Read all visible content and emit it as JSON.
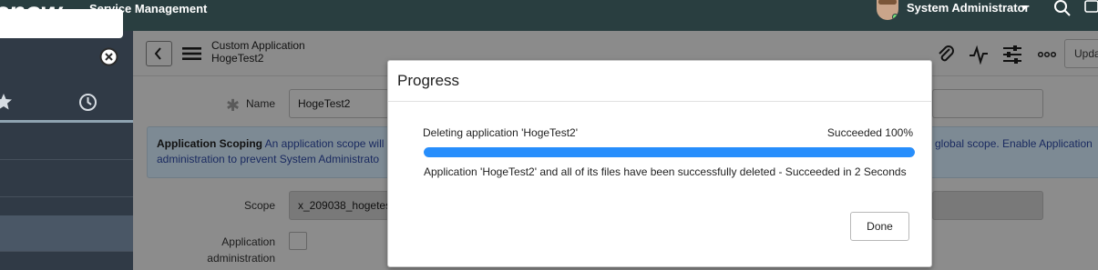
{
  "banner": {
    "logo_text": "enow",
    "app_name": "Service Management",
    "user_name": "System Administrator"
  },
  "icons": {
    "search": "search-icon",
    "chat": "chat-icon",
    "clear": "clear-filter-icon",
    "favorites": "star-icon",
    "history": "clock-icon",
    "attachment": "paperclip-icon",
    "activity": "activity-icon",
    "settings": "sliders-icon",
    "more": "more-options-icon"
  },
  "form": {
    "title_line1": "Custom Application",
    "title_line2": "HogeTest2",
    "update_label": "Upda",
    "name_label": "Name",
    "name_value": "HogeTest2",
    "scope_notice_heading": "Application Scoping",
    "scope_notice_line1_start": "An application scope will p",
    "scope_notice_line1_end": "global scope. Enable Application",
    "scope_notice_line2": "administration to prevent System Administrato",
    "scope_label": "Scope",
    "scope_value": "x_209038_hogetes",
    "app_admin_label_1": "Application",
    "app_admin_label_2": "administration"
  },
  "modal": {
    "title": "Progress",
    "task_name": "Deleting application 'HogeTest2'",
    "task_status": "Succeeded 100%",
    "progress_percent": 100,
    "result_message": "Application 'HogeTest2' and all of its files have been successfully deleted - Succeeded in 2 Seconds",
    "done_label": "Done"
  },
  "colors": {
    "banner": "#293e40",
    "nav": "#303a46",
    "progress": "#278efc"
  }
}
